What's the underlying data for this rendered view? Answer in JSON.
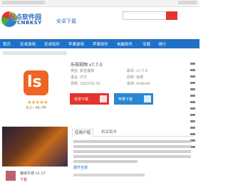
{
  "colors": {
    "brand_blue": "#2071c6",
    "download_red": "#e3342f",
    "download_blue": "#2a86d1",
    "app_icon_orange": "#ee6423",
    "star_yellow": "#f5a623"
  },
  "logo": {
    "cn": "起点软件园",
    "en": "CNBKSY",
    "tagline": "安卓下载"
  },
  "nav": {
    "items": [
      "首页",
      "安卓游戏",
      "安卓软件",
      "苹果游戏",
      "苹果软件",
      "电脑软件",
      "专题",
      "排行"
    ]
  },
  "app": {
    "title": "乐视视频 v7.7.0",
    "icon_letters": "ls",
    "stars": "★★★★★",
    "size": "大小: 48.7M",
    "meta": [
      "类型: 影音播放",
      "语言: 中文",
      "更新: 2023-01-01",
      "版本: v7.7.0",
      "授权: 免费",
      "系统: Android"
    ],
    "download_android": "安卓下载",
    "download_ios": "苹果下载"
  },
  "recommend": {
    "title": "魔域手游 v1.17",
    "sub": "下载"
  },
  "tabs": [
    "应用介绍",
    "相关版本"
  ],
  "more_link": "展开全部"
}
